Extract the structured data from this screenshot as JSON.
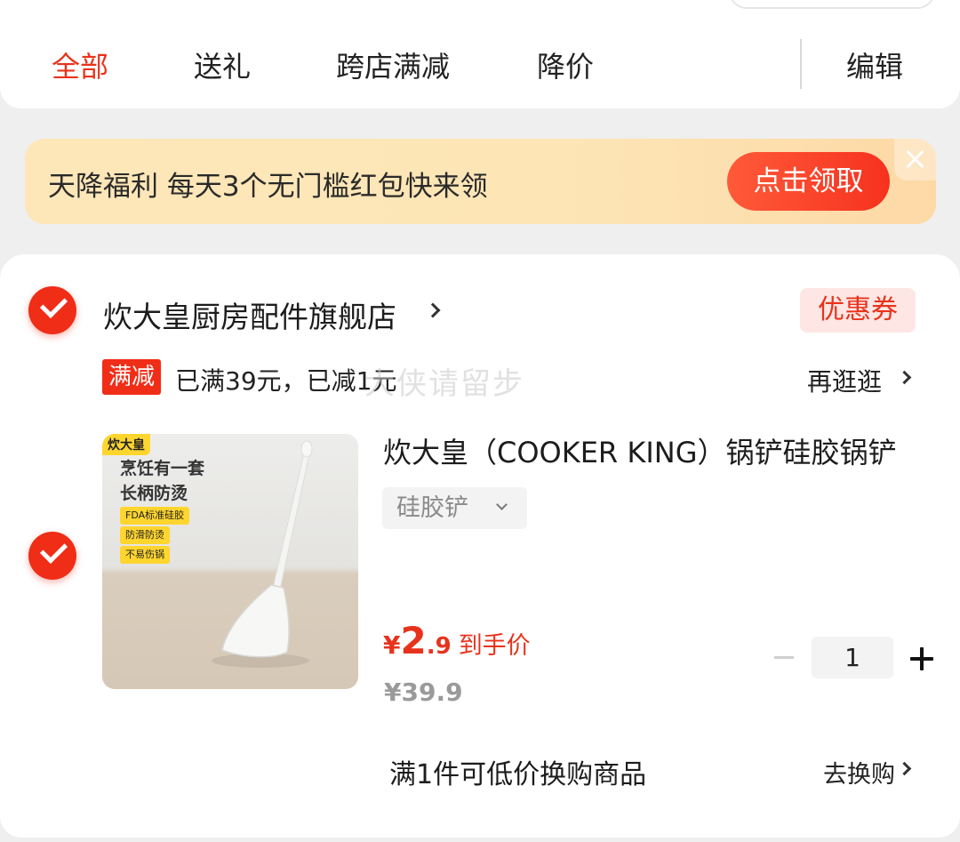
{
  "tabs": [
    {
      "label": "全部",
      "active": true
    },
    {
      "label": "送礼",
      "active": false
    },
    {
      "label": "跨店满减",
      "active": false
    },
    {
      "label": "降价",
      "active": false
    }
  ],
  "edit_label": "编辑",
  "banner": {
    "text": "天降福利 每天3个无门槛红包快来领",
    "button": "点击领取"
  },
  "store": {
    "name": "炊大皇厨房配件旗舰店",
    "coupon_label": "优惠券",
    "promo_tag": "满减",
    "promo_text": "已满39元，已减1元",
    "watermark": "大侠请留步",
    "browse_label": "再逛逛",
    "selected": true
  },
  "product": {
    "selected": true,
    "title": "炊大皇（COOKER KING）锅铲硅胶锅铲",
    "variant": "硅胶铲",
    "price_symbol": "¥",
    "price_int": "2",
    "price_dec": ".9",
    "price_label": "到手价",
    "original_price": "¥39.9",
    "quantity": "1",
    "image": {
      "brand": "炊大皇",
      "line1": "烹饪有一套",
      "line2": "长柄防烫",
      "badges": [
        "FDA标准硅胶",
        "防滑防烫",
        "不易伤锅"
      ]
    }
  },
  "swap": {
    "text": "满1件可低价换购商品",
    "link": "去换购"
  },
  "colors": {
    "accent": "#e8331c",
    "check": "#f02d17",
    "banner_bg": "#fde7b8"
  }
}
